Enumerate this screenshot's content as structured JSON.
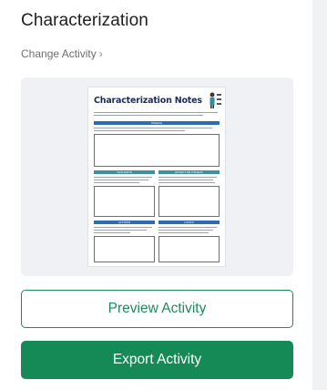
{
  "header": {
    "title": "Characterization",
    "change_link": "Change Activity",
    "chevron": "›"
  },
  "preview": {
    "sheet_title": "Characterization Notes",
    "sections": [
      "SPEECH",
      "THOUGHTS",
      "EFFECT ON OTHERS",
      "ACTIONS",
      "LOOKS"
    ]
  },
  "buttons": {
    "preview": "Preview Activity",
    "export": "Export Activity"
  },
  "colors": {
    "accent": "#168a56",
    "outline": "#1a8b5a",
    "card_bg": "#f0f1f4"
  }
}
